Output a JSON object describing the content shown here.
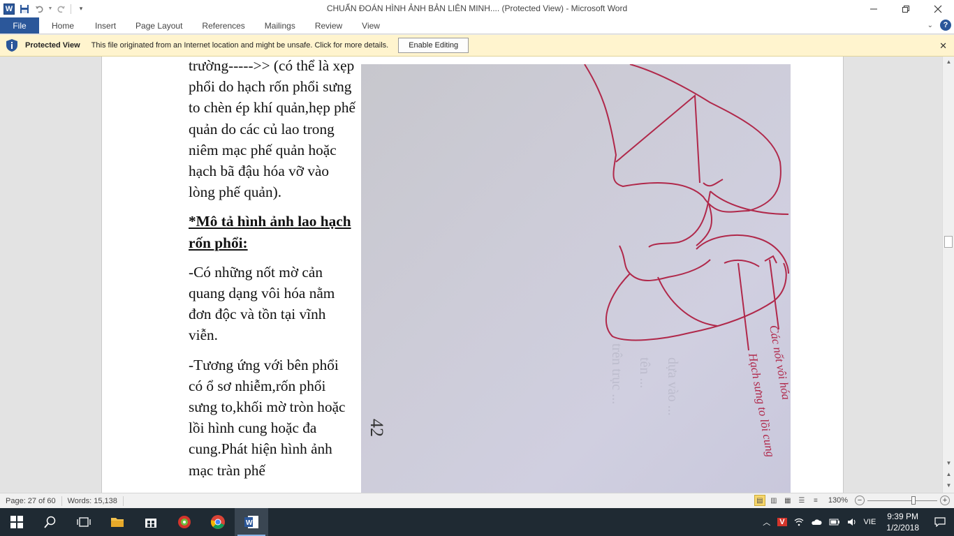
{
  "titlebar": {
    "title": "CHUẨN ĐOÁN HÌNH ẢNH BẢN LIÊN MINH.... (Protected View)  -  Microsoft Word",
    "app_letter": "W",
    "save_icon": "floppy-icon",
    "undo_icon": "undo-icon",
    "redo_icon": "redo-icon"
  },
  "ribbon": {
    "file": "File",
    "tabs": [
      "Home",
      "Insert",
      "Page Layout",
      "References",
      "Mailings",
      "Review",
      "View"
    ],
    "help": "?"
  },
  "protected_view": {
    "title": "Protected View",
    "message": "This file originated from an Internet location and might be unsafe. Click for more details.",
    "button": "Enable Editing",
    "accent": "#fff4ce"
  },
  "document": {
    "paragraph1": "trường----->> (có thể là xẹp phổi do hạch rốn phổi sưng to chèn ép khí quản,hẹp phế quản do các củ lao trong niêm mạc phế quản hoặc hạch bã đậu hóa vỡ vào lòng phế quản).",
    "heading": "*Mô tả hình ảnh lao hạch rốn phổi:",
    "paragraph2": "-Có những nốt mờ cản quang dạng vôi hóa nằm đơn độc và tồn tại vĩnh viễn.",
    "paragraph3": "-Tương ứng với bên phổi có ổ sơ nhiễm,rốn phổi sưng to,khối mờ tròn hoặc lồi hình cung hoặc đa cung.Phát hiện hình ảnh mạc tràn phế"
  },
  "photo": {
    "annotation_1": "Các nốt vôi hóa",
    "annotation_2": "Hạch sưng to lồi cung",
    "page_mark": "42",
    "ink_color": "#b0284a"
  },
  "statusbar": {
    "page": "Page: 27 of 60",
    "words": "Words: 15,138",
    "zoom": "130%",
    "zoom_value": 130
  },
  "taskbar": {
    "apps": [
      "start-icon",
      "search-icon",
      "task-view-icon",
      "file-explorer-icon",
      "store-icon",
      "app-icon",
      "chrome-icon",
      "word-icon"
    ],
    "language": "VIE",
    "time": "9:39 PM",
    "date": "1/2/2018"
  }
}
